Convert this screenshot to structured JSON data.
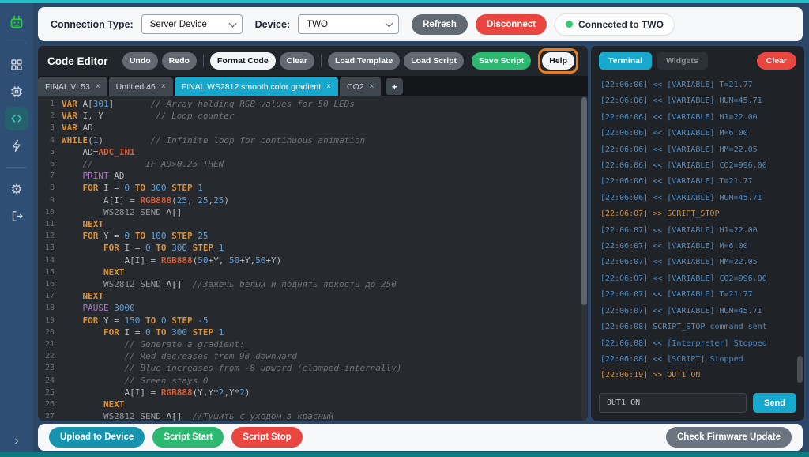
{
  "colors": {
    "accent_teal": "#17a9cd",
    "green": "#2db871",
    "red": "#e8463f",
    "help_highlight_orange": "#e87c1e",
    "terminal_rx_blue": "#4a8bc7",
    "terminal_tx_orange": "#c98a3e",
    "status_dot_green": "#2ecc71"
  },
  "connection_bar": {
    "connection_type_label": "Connection Type:",
    "connection_type_value": "Server Device",
    "device_label": "Device:",
    "device_value": "TWO",
    "refresh_label": "Refresh",
    "disconnect_label": "Disconnect",
    "status_text": "Connected to TWO"
  },
  "editor": {
    "title": "Code Editor",
    "toolbar": {
      "undo": "Undo",
      "redo": "Redo",
      "format": "Format Code",
      "clear": "Clear",
      "load_template": "Load Template",
      "load_script": "Load Script",
      "save_script": "Save Script",
      "help": "Help"
    },
    "tab_close_glyph": "×",
    "add_tab_label": "+",
    "tabs": [
      {
        "label": "FINAL VL53",
        "active": false
      },
      {
        "label": "Untitled 46",
        "active": false
      },
      {
        "label": "FINAL WS2812 smooth color gradient",
        "active": true
      },
      {
        "label": "CO2",
        "active": false
      }
    ],
    "code_lines": [
      [
        [
          "kw",
          "VAR"
        ],
        [
          "pln",
          " A["
        ],
        [
          "num",
          "301"
        ],
        [
          "pln",
          "]       "
        ],
        [
          "com",
          "// Array holding RGB values for 50 LEDs"
        ]
      ],
      [
        [
          "kw",
          "VAR"
        ],
        [
          "pln",
          " I, Y          "
        ],
        [
          "com",
          "// Loop counter"
        ]
      ],
      [
        [
          "kw",
          "VAR"
        ],
        [
          "pln",
          " AD"
        ]
      ],
      [
        [
          "kw",
          "WHILE"
        ],
        [
          "pln",
          "("
        ],
        [
          "num",
          "1"
        ],
        [
          "pln",
          ")         "
        ],
        [
          "com",
          "// Infinite loop for continuous animation"
        ]
      ],
      [
        [
          "pln",
          "    AD="
        ],
        [
          "bi",
          "ADC_IN1"
        ]
      ],
      [
        [
          "pln",
          "    "
        ],
        [
          "com",
          "//          IF AD>0.25 THEN"
        ]
      ],
      [
        [
          "pln",
          "    "
        ],
        [
          "fn",
          "PRINT"
        ],
        [
          "pln",
          " AD"
        ]
      ],
      [
        [
          "pln",
          "    "
        ],
        [
          "kw",
          "FOR"
        ],
        [
          "pln",
          " I = "
        ],
        [
          "num",
          "0"
        ],
        [
          "pln",
          " "
        ],
        [
          "kw",
          "TO"
        ],
        [
          "pln",
          " "
        ],
        [
          "num",
          "300"
        ],
        [
          "pln",
          " "
        ],
        [
          "kw",
          "STEP"
        ],
        [
          "pln",
          " "
        ],
        [
          "num",
          "1"
        ]
      ],
      [
        [
          "pln",
          "        A[I] = "
        ],
        [
          "bi",
          "RGB888"
        ],
        [
          "pln",
          "("
        ],
        [
          "num",
          "25"
        ],
        [
          "pln",
          ", "
        ],
        [
          "num",
          "25"
        ],
        [
          "pln",
          ","
        ],
        [
          "num",
          "25"
        ],
        [
          "pln",
          ")"
        ]
      ],
      [
        [
          "pln",
          "        "
        ],
        [
          "sub",
          "WS2812_SEND"
        ],
        [
          "pln",
          " A[]"
        ]
      ],
      [
        [
          "pln",
          "    "
        ],
        [
          "kw",
          "NEXT"
        ]
      ],
      [
        [
          "pln",
          "    "
        ],
        [
          "kw",
          "FOR"
        ],
        [
          "pln",
          " Y = "
        ],
        [
          "num",
          "0"
        ],
        [
          "pln",
          " "
        ],
        [
          "kw",
          "TO"
        ],
        [
          "pln",
          " "
        ],
        [
          "num",
          "100"
        ],
        [
          "pln",
          " "
        ],
        [
          "kw",
          "STEP"
        ],
        [
          "pln",
          " "
        ],
        [
          "num",
          "25"
        ]
      ],
      [
        [
          "pln",
          "        "
        ],
        [
          "kw",
          "FOR"
        ],
        [
          "pln",
          " I = "
        ],
        [
          "num",
          "0"
        ],
        [
          "pln",
          " "
        ],
        [
          "kw",
          "TO"
        ],
        [
          "pln",
          " "
        ],
        [
          "num",
          "300"
        ],
        [
          "pln",
          " "
        ],
        [
          "kw",
          "STEP"
        ],
        [
          "pln",
          " "
        ],
        [
          "num",
          "1"
        ]
      ],
      [
        [
          "pln",
          "            A[I] = "
        ],
        [
          "bi",
          "RGB888"
        ],
        [
          "pln",
          "("
        ],
        [
          "num",
          "50"
        ],
        [
          "pln",
          "+Y, "
        ],
        [
          "num",
          "50"
        ],
        [
          "pln",
          "+Y,"
        ],
        [
          "num",
          "50"
        ],
        [
          "pln",
          "+Y)"
        ]
      ],
      [
        [
          "pln",
          "        "
        ],
        [
          "kw",
          "NEXT"
        ]
      ],
      [
        [
          "pln",
          "        "
        ],
        [
          "sub",
          "WS2812_SEND"
        ],
        [
          "pln",
          " A[]  "
        ],
        [
          "com",
          "//Зажечь белый и поднять яркость до 250"
        ]
      ],
      [
        [
          "pln",
          "    "
        ],
        [
          "kw",
          "NEXT"
        ]
      ],
      [
        [
          "pln",
          "    "
        ],
        [
          "fn",
          "PAUSE"
        ],
        [
          "pln",
          " "
        ],
        [
          "num",
          "3000"
        ]
      ],
      [
        [
          "pln",
          "    "
        ],
        [
          "kw",
          "FOR"
        ],
        [
          "pln",
          " Y = "
        ],
        [
          "num",
          "150"
        ],
        [
          "pln",
          " "
        ],
        [
          "kw",
          "TO"
        ],
        [
          "pln",
          " "
        ],
        [
          "num",
          "0"
        ],
        [
          "pln",
          " "
        ],
        [
          "kw",
          "STEP"
        ],
        [
          "pln",
          " "
        ],
        [
          "num",
          "-5"
        ]
      ],
      [
        [
          "pln",
          "        "
        ],
        [
          "kw",
          "FOR"
        ],
        [
          "pln",
          " I = "
        ],
        [
          "num",
          "0"
        ],
        [
          "pln",
          " "
        ],
        [
          "kw",
          "TO"
        ],
        [
          "pln",
          " "
        ],
        [
          "num",
          "300"
        ],
        [
          "pln",
          " "
        ],
        [
          "kw",
          "STEP"
        ],
        [
          "pln",
          " "
        ],
        [
          "num",
          "1"
        ]
      ],
      [
        [
          "pln",
          "            "
        ],
        [
          "com",
          "// Generate a gradient:"
        ]
      ],
      [
        [
          "pln",
          "            "
        ],
        [
          "com",
          "// Red decreases from 98 downward"
        ]
      ],
      [
        [
          "pln",
          "            "
        ],
        [
          "com",
          "// Blue increases from -8 upward (clamped internally)"
        ]
      ],
      [
        [
          "pln",
          "            "
        ],
        [
          "com",
          "// Green stays 0"
        ]
      ],
      [
        [
          "pln",
          "            A[I] = "
        ],
        [
          "bi",
          "RGB888"
        ],
        [
          "pln",
          "(Y,Y*"
        ],
        [
          "num",
          "2"
        ],
        [
          "pln",
          ",Y*"
        ],
        [
          "num",
          "2"
        ],
        [
          "pln",
          ")"
        ]
      ],
      [
        [
          "pln",
          "        "
        ],
        [
          "kw",
          "NEXT"
        ]
      ],
      [
        [
          "pln",
          "        "
        ],
        [
          "sub",
          "WS2812_SEND"
        ],
        [
          "pln",
          " A[]  "
        ],
        [
          "com",
          "//Тушить с уходом в красный"
        ]
      ]
    ]
  },
  "terminal": {
    "tabs": [
      {
        "label": "Terminal",
        "active": true
      },
      {
        "label": "Widgets",
        "active": false
      }
    ],
    "clear_label": "Clear",
    "lines": [
      {
        "text": "[22:06:06] << [VARIABLE] T=21.77",
        "tone": "rx"
      },
      {
        "text": "[22:06:06] << [VARIABLE] HUM=45.71",
        "tone": "rx"
      },
      {
        "text": "[22:06:06] << [VARIABLE] H1=22.00",
        "tone": "rx"
      },
      {
        "text": "[22:06:06] << [VARIABLE] M=6.00",
        "tone": "rx"
      },
      {
        "text": "[22:06:06] << [VARIABLE] HM=22.05",
        "tone": "rx"
      },
      {
        "text": "[22:06:06] << [VARIABLE] CO2=996.00",
        "tone": "rx"
      },
      {
        "text": "[22:06:06] << [VARIABLE] T=21.77",
        "tone": "rx"
      },
      {
        "text": "[22:06:06] << [VARIABLE] HUM=45.71",
        "tone": "rx"
      },
      {
        "text": "[22:06:07] >> SCRIPT_STOP",
        "tone": "tx"
      },
      {
        "text": "[22:06:07] << [VARIABLE] H1=22.00",
        "tone": "rx"
      },
      {
        "text": "[22:06:07] << [VARIABLE] M=6.00",
        "tone": "rx"
      },
      {
        "text": "[22:06:07] << [VARIABLE] HM=22.05",
        "tone": "rx"
      },
      {
        "text": "[22:06:07] << [VARIABLE] CO2=996.00",
        "tone": "rx"
      },
      {
        "text": "[22:06:07] << [VARIABLE] T=21.77",
        "tone": "rx"
      },
      {
        "text": "[22:06:07] << [VARIABLE] HUM=45.71",
        "tone": "rx"
      },
      {
        "text": "[22:06:08] SCRIPT_STOP command sent",
        "tone": "rx"
      },
      {
        "text": "[22:06:08] << [Interpreter] Stopped",
        "tone": "rx"
      },
      {
        "text": "[22:06:08] << [SCRIPT] Stopped",
        "tone": "rx"
      },
      {
        "text": "[22:06:19] >> OUT1 ON",
        "tone": "tx"
      }
    ],
    "input_value": "OUT1 ON",
    "send_label": "Send"
  },
  "bottom_bar": {
    "upload_label": "Upload to Device",
    "script_start_label": "Script Start",
    "script_stop_label": "Script Stop",
    "firmware_label": "Check Firmware Update"
  }
}
